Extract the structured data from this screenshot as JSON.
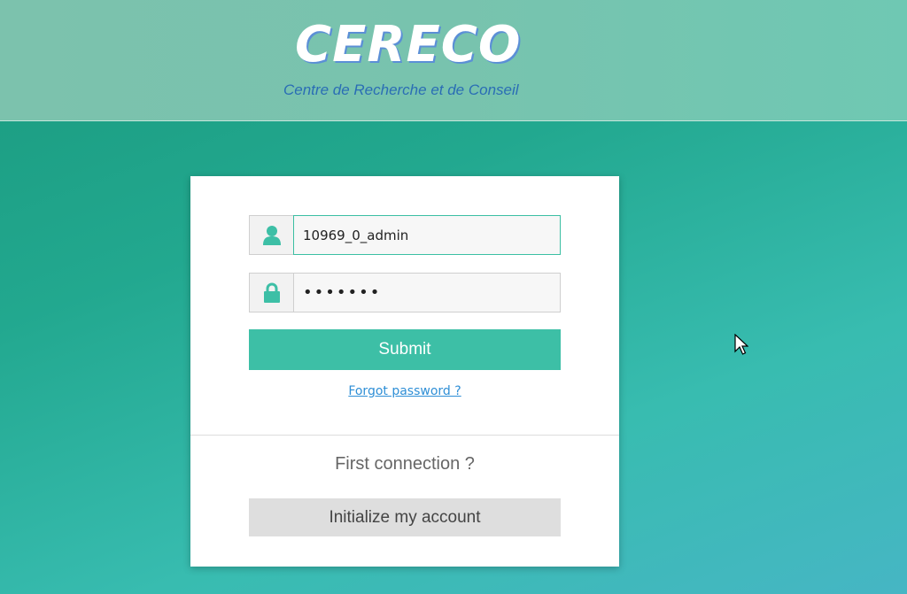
{
  "header": {
    "brand": "CERECO",
    "tagline": "Centre de Recherche et de Conseil"
  },
  "login": {
    "username_value": "10969_0_admin",
    "password_value": "•••••••",
    "username_icon": "user-icon",
    "password_icon": "lock-icon",
    "submit_label": "Submit",
    "forgot_link": "Forgot password ?"
  },
  "first_connection": {
    "heading": "First connection ?",
    "button_label": "Initialize my account"
  },
  "colors": {
    "accent": "#3dbfa6",
    "link": "#2f8fd6",
    "brand_shadow": "#5b8fd6",
    "tagline": "#2a6db5"
  }
}
